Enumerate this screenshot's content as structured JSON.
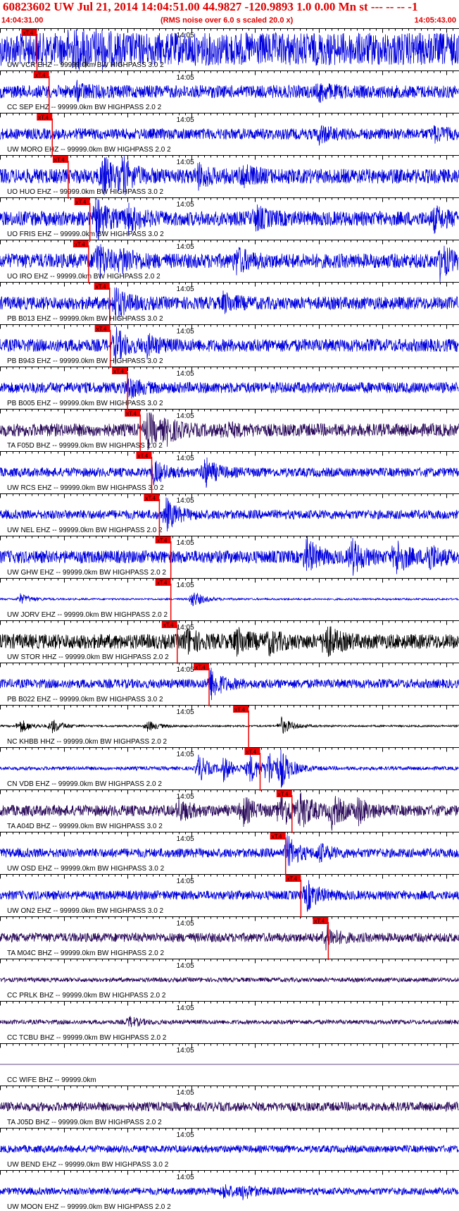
{
  "header": {
    "title": "60823602 UW Jul 21, 2014 14:04:51.00   44.9827 -120.9893  1.0 0.00 Mn st --- -- --  -1",
    "start_time": "14:04:31.00",
    "noise_note": "(RMS noise over 6.0 s scaled 20.0 x)",
    "end_time": "14:05:43.00"
  },
  "chart_data": {
    "type": "line",
    "x_range_seconds": [
      0,
      72
    ],
    "time_marker": {
      "label": "14:05",
      "at_seconds": 29
    },
    "pick_label": "xT.4",
    "colors": {
      "default": "#0000dd",
      "broadband": "#2a0a5a",
      "black": "#000000",
      "pick": "#ee0000",
      "text": "#000000"
    },
    "traces": [
      {
        "label": "UW VCR EHZ -- 99999.0km BW  HIGHPASS  3.0  2",
        "pick_s": 5.8,
        "amp": 0.9,
        "color": "default",
        "bursts": [
          [
            11,
            0.9
          ],
          [
            15,
            0.4
          ]
        ]
      },
      {
        "label": "CC SEP EHZ -- 99999.0km BW  HIGHPASS  2.0  2",
        "pick_s": 7.7,
        "amp": 0.35,
        "color": "default",
        "bursts": [
          [
            12,
            0.3
          ],
          [
            50,
            0.35
          ]
        ]
      },
      {
        "label": "UW MORO EHZ -- 99999.0km BW  HIGHPASS  2.0  2",
        "pick_s": 8.2,
        "amp": 0.3,
        "color": "default",
        "bursts": [
          [
            50,
            0.4
          ],
          [
            68,
            0.3
          ]
        ]
      },
      {
        "label": "UO HUO EHZ -- 99999.0km BW  HIGHPASS  3.0  2",
        "pick_s": 10.7,
        "amp": 0.4,
        "color": "default",
        "bursts": [
          [
            16,
            1.0
          ],
          [
            19,
            0.8
          ],
          [
            31,
            0.5
          ],
          [
            38,
            0.5
          ]
        ]
      },
      {
        "label": "UO FRIS EHZ -- 99999.0km BW  HIGHPASS  3.0  2",
        "pick_s": 14.1,
        "amp": 0.4,
        "color": "default",
        "bursts": [
          [
            15,
            1.0
          ],
          [
            20,
            0.6
          ],
          [
            40,
            0.5
          ],
          [
            68,
            0.5
          ]
        ]
      },
      {
        "label": "UO IRO EHZ -- 99999.0km BW  HIGHPASS  2.0  2",
        "pick_s": 13.9,
        "amp": 0.4,
        "color": "default",
        "bursts": [
          [
            15,
            1.0
          ],
          [
            19,
            0.6
          ],
          [
            37,
            0.6
          ],
          [
            69,
            0.8
          ]
        ]
      },
      {
        "label": "PB B013 EHZ -- 99999.0km BW  HIGHPASS  3.0  2",
        "pick_s": 17.2,
        "amp": 0.35,
        "color": "default",
        "bursts": [
          [
            18,
            0.8
          ],
          [
            35,
            0.4
          ]
        ]
      },
      {
        "label": "PB B943 EHZ -- 99999.0km BW  HIGHPASS  3.0  2",
        "pick_s": 17.3,
        "amp": 0.35,
        "color": "default",
        "bursts": [
          [
            18,
            0.8
          ],
          [
            23,
            0.4
          ]
        ]
      },
      {
        "label": "PB B005 EHZ -- 99999.0km BW  HIGHPASS  3.0  2",
        "pick_s": 20.0,
        "amp": 0.3,
        "color": "default",
        "bursts": [
          [
            20,
            0.5
          ]
        ]
      },
      {
        "label": "TA F05D BHZ -- 99999.0km BW  HIGHPASS  2.0  2",
        "pick_s": 22.0,
        "amp": 0.35,
        "color": "broadband",
        "bursts": [
          [
            23,
            0.9
          ],
          [
            26,
            0.5
          ],
          [
            35,
            0.3
          ]
        ]
      },
      {
        "label": "UW RCS EHZ -- 99999.0km BW  HIGHPASS  3.0  2",
        "pick_s": 23.8,
        "amp": 0.25,
        "color": "default",
        "bursts": [
          [
            24,
            0.6
          ],
          [
            32,
            0.8
          ]
        ]
      },
      {
        "label": "UW NEL EHZ -- 99999.0km BW  HIGHPASS  2.0  2",
        "pick_s": 25.0,
        "amp": 0.25,
        "color": "default",
        "bursts": [
          [
            26,
            0.8
          ]
        ]
      },
      {
        "label": "UW GHW EHZ -- 99999.0km BW  HIGHPASS  2.0  2",
        "pick_s": 26.8,
        "amp": 0.35,
        "color": "default",
        "bursts": [
          [
            48,
            0.9
          ],
          [
            55,
            0.9
          ],
          [
            62,
            0.9
          ],
          [
            67,
            0.7
          ]
        ]
      },
      {
        "label": "UW JORV EHZ -- 99999.0km BW  HIGHPASS  2.0  2",
        "pick_s": 26.8,
        "amp": 0.05,
        "color": "default",
        "bursts": [
          [
            3,
            0.3
          ],
          [
            30,
            0.5
          ]
        ]
      },
      {
        "label": "UW STOR HHZ -- 99999.0km BW  HIGHPASS  2.0  2",
        "pick_s": 27.8,
        "amp": 0.4,
        "color": "black",
        "bursts": [
          [
            29,
            0.6
          ],
          [
            37,
            0.6
          ],
          [
            42,
            0.5
          ],
          [
            51,
            0.8
          ]
        ]
      },
      {
        "label": "PB B022 EHZ -- 99999.0km BW  HIGHPASS  3.0  2",
        "pick_s": 32.8,
        "amp": 0.25,
        "color": "default",
        "bursts": [
          [
            33,
            0.8
          ]
        ]
      },
      {
        "label": "NC KHBB HHZ -- 99999.0km BW  HIGHPASS  2.0  2",
        "pick_s": 39.0,
        "amp": 0.05,
        "color": "black",
        "bursts": [
          [
            3,
            0.4
          ],
          [
            8,
            0.4
          ],
          [
            23,
            0.3
          ],
          [
            44,
            0.5
          ]
        ]
      },
      {
        "label": "CN VDB EHZ -- 99999.0km BW  HIGHPASS  2.0  2",
        "pick_s": 40.8,
        "amp": 0.1,
        "color": "default",
        "bursts": [
          [
            31,
            0.8
          ],
          [
            35,
            0.6
          ],
          [
            39,
            0.8
          ],
          [
            42,
            0.9
          ],
          [
            44,
            0.8
          ]
        ]
      },
      {
        "label": "TA A04D BHZ -- 99999.0km BW  HIGHPASS  3.0  2",
        "pick_s": 45.8,
        "amp": 0.3,
        "color": "broadband",
        "bursts": [
          [
            28,
            0.5
          ],
          [
            38,
            0.7
          ],
          [
            44,
            0.9
          ],
          [
            47,
            0.9
          ],
          [
            52,
            0.8
          ],
          [
            56,
            0.6
          ]
        ]
      },
      {
        "label": "UW OSD EHZ -- 99999.0km BW  HIGHPASS  3.0  2",
        "pick_s": 44.8,
        "amp": 0.25,
        "color": "default",
        "bursts": [
          [
            45,
            0.8
          ],
          [
            50,
            0.4
          ]
        ]
      },
      {
        "label": "UW ON2 EHZ -- 99999.0km BW  HIGHPASS  3.0  2",
        "pick_s": 47.2,
        "amp": 0.25,
        "color": "default",
        "bursts": [
          [
            48,
            0.8
          ]
        ]
      },
      {
        "label": "TA M04C BHZ -- 99999.0km BW  HIGHPASS  2.0  2",
        "pick_s": 51.5,
        "amp": 0.25,
        "color": "broadband",
        "bursts": [
          [
            51,
            0.6
          ]
        ]
      },
      {
        "label": "CC PRLK BHZ -- 99999.0km BW  HIGHPASS  2.0  2",
        "pick_s": null,
        "amp": 0.12,
        "color": "broadband",
        "bursts": []
      },
      {
        "label": "CC TCBU BHZ -- 99999.0km BW  HIGHPASS  2.0  2",
        "pick_s": null,
        "amp": 0.12,
        "color": "broadband",
        "bursts": [
          [
            20,
            0.3
          ]
        ]
      },
      {
        "label": "CC WIFE BHZ -- 99999.0km",
        "pick_s": null,
        "amp": 0.0,
        "color": "broadband",
        "bursts": []
      },
      {
        "label": "TA J05D BHZ -- 99999.0km BW  HIGHPASS  2.0  2",
        "pick_s": null,
        "amp": 0.25,
        "color": "broadband",
        "bursts": []
      },
      {
        "label": "UW BEND EHZ -- 99999.0km BW  HIGHPASS  3.0  2",
        "pick_s": null,
        "amp": 0.2,
        "color": "default",
        "bursts": []
      },
      {
        "label": "UW MOON EHZ -- 99999.0km BW  HIGHPASS  2.0  2",
        "pick_s": null,
        "amp": 0.2,
        "color": "default",
        "bursts": [
          [
            35,
            0.3
          ],
          [
            38,
            0.3
          ]
        ]
      }
    ]
  }
}
